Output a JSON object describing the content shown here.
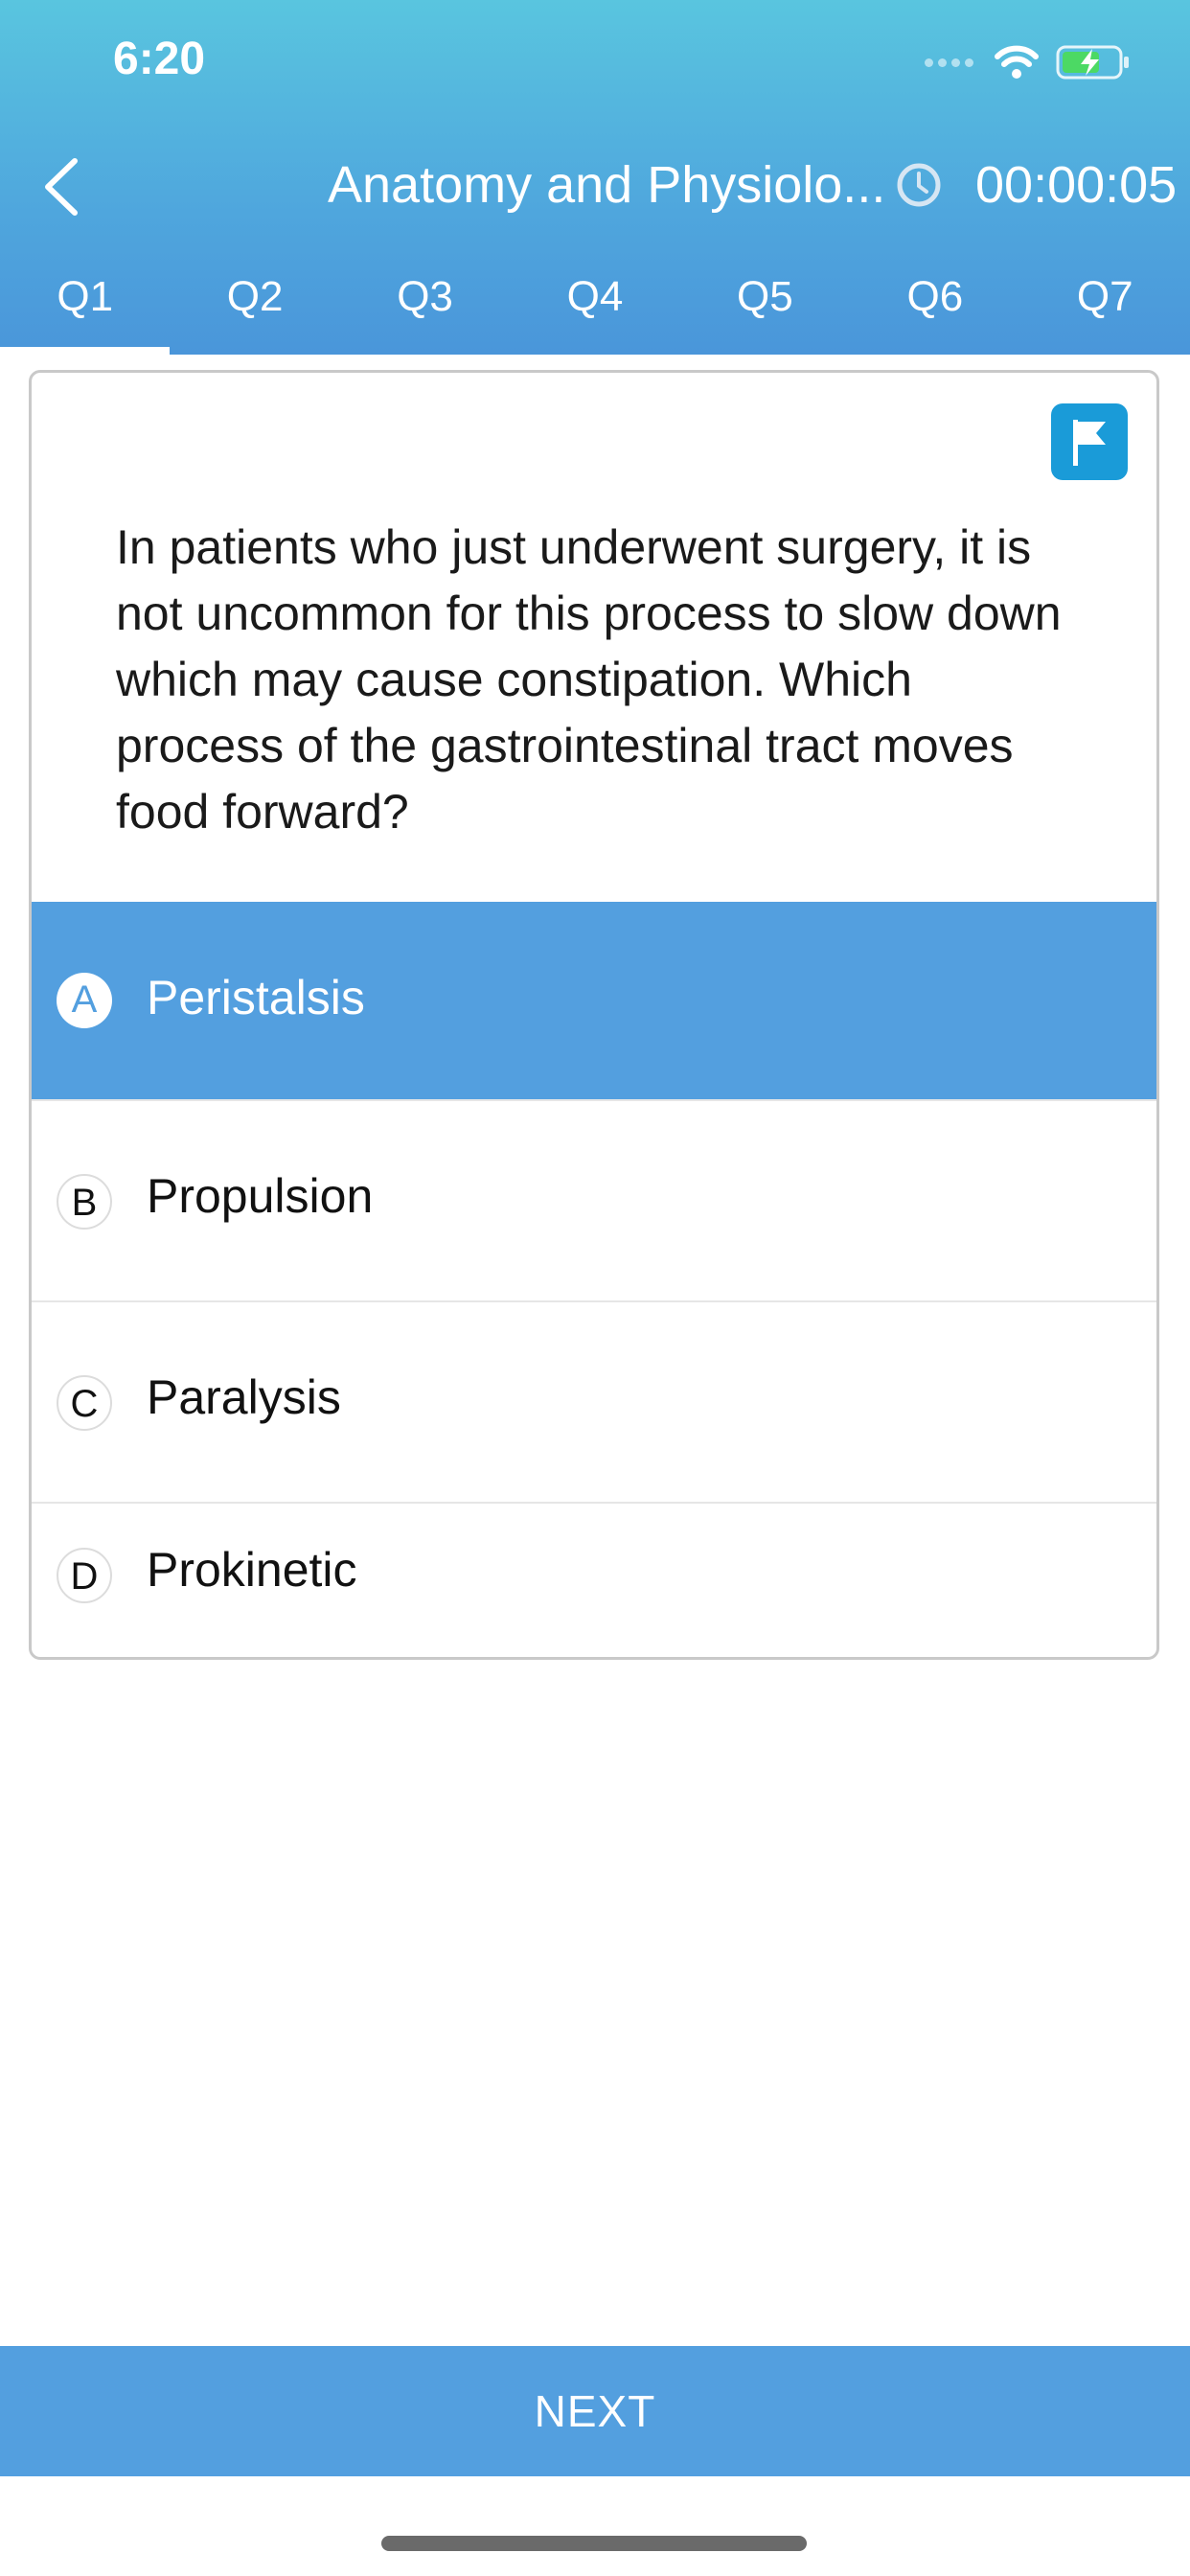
{
  "status_bar": {
    "time": "6:20"
  },
  "header": {
    "title": "Anatomy and Physiolo...",
    "timer": "00:00:05",
    "tabs": [
      {
        "label": "Q1",
        "active": true
      },
      {
        "label": "Q2",
        "active": false
      },
      {
        "label": "Q3",
        "active": false
      },
      {
        "label": "Q4",
        "active": false
      },
      {
        "label": "Q5",
        "active": false
      },
      {
        "label": "Q6",
        "active": false
      },
      {
        "label": "Q7",
        "active": false
      }
    ]
  },
  "question": {
    "text": "In patients who just underwent surgery, it is not uncommon for this process to slow down which may cause constipation.  Which process of the gastrointestinal tract moves food forward?",
    "options": [
      {
        "letter": "A",
        "label": "Peristalsis",
        "selected": true
      },
      {
        "letter": "B",
        "label": "Propulsion",
        "selected": false
      },
      {
        "letter": "C",
        "label": "Paralysis",
        "selected": false
      },
      {
        "letter": "D",
        "label": "Prokinetic",
        "selected": false
      }
    ]
  },
  "footer": {
    "next_label": "NEXT"
  },
  "colors": {
    "accent": "#539fdf",
    "header_top": "#59c5df",
    "flag": "#1a9bd8",
    "battery_green": "#4cd964"
  },
  "icons": [
    "back-chevron-icon",
    "clock-icon",
    "flag-icon",
    "wifi-icon",
    "battery-icon",
    "signal-icon"
  ]
}
